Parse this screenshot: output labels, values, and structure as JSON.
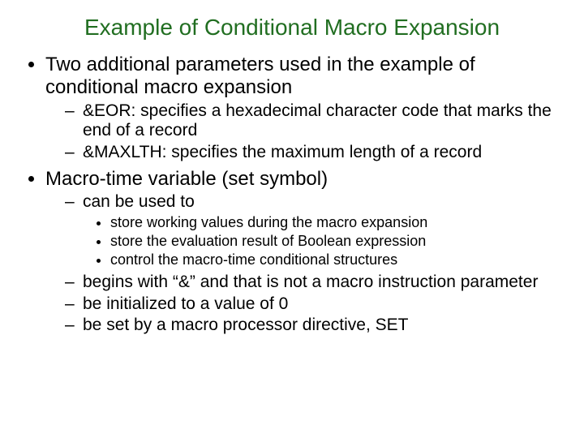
{
  "title": "Example of Conditional Macro Expansion",
  "b1": {
    "text": "Two additional parameters used in the example of conditional macro expansion",
    "sub": [
      "&EOR: specifies a hexadecimal character code that marks the end of a record",
      "&MAXLTH: specifies the maximum length of a record"
    ]
  },
  "b2": {
    "text": "Macro-time variable (set symbol)",
    "sub1": {
      "text": "can be used to",
      "sub": [
        "store working values during the macro expansion",
        "store the evaluation result of Boolean expression",
        "control the macro-time conditional structures"
      ]
    },
    "sub2": "begins with “&” and that is not a macro instruction parameter",
    "sub3": "be initialized to a value of 0",
    "sub4": "be set by a macro processor directive, SET"
  }
}
